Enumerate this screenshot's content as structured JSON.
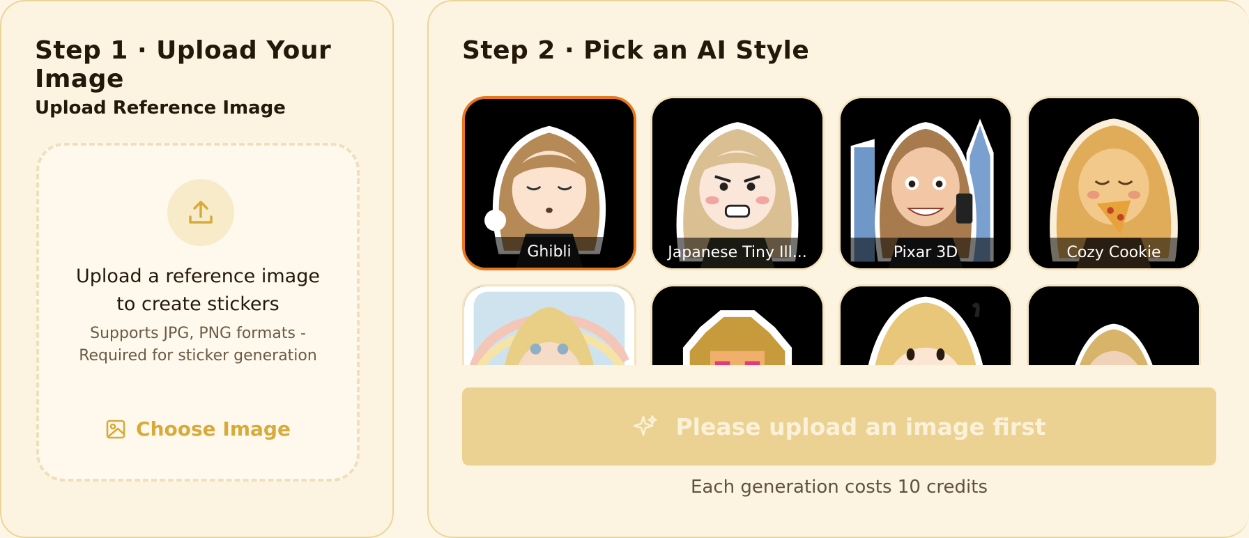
{
  "step1": {
    "title": "Step 1 · Upload Your Image",
    "section_label": "Upload Reference Image",
    "dropzone": {
      "icon": "upload-icon",
      "title_line1": "Upload a reference image",
      "title_line2": "to create stickers",
      "subtitle": "Supports JPG, PNG formats - Required for sticker generation",
      "choose_label": "Choose Image",
      "choose_icon": "image-icon"
    }
  },
  "step2": {
    "title": "Step 2 · Pick an AI Style",
    "styles": [
      {
        "label": "Ghibli",
        "selected": true
      },
      {
        "label": "Japanese Tiny Ill...",
        "selected": false
      },
      {
        "label": "Pixar 3D",
        "selected": false
      },
      {
        "label": "Cozy Cookie",
        "selected": false
      },
      {
        "label": "",
        "selected": false
      },
      {
        "label": "",
        "selected": false
      },
      {
        "label": "",
        "selected": false
      },
      {
        "label": "",
        "selected": false
      }
    ],
    "generate_label": "Please upload an image first",
    "generate_icon": "sparkle-icon",
    "cost_note": "Each generation costs 10 credits"
  },
  "colors": {
    "accent": "#d8aa3a",
    "selected_border": "#e8761c",
    "button_disabled": "#ebd293"
  }
}
